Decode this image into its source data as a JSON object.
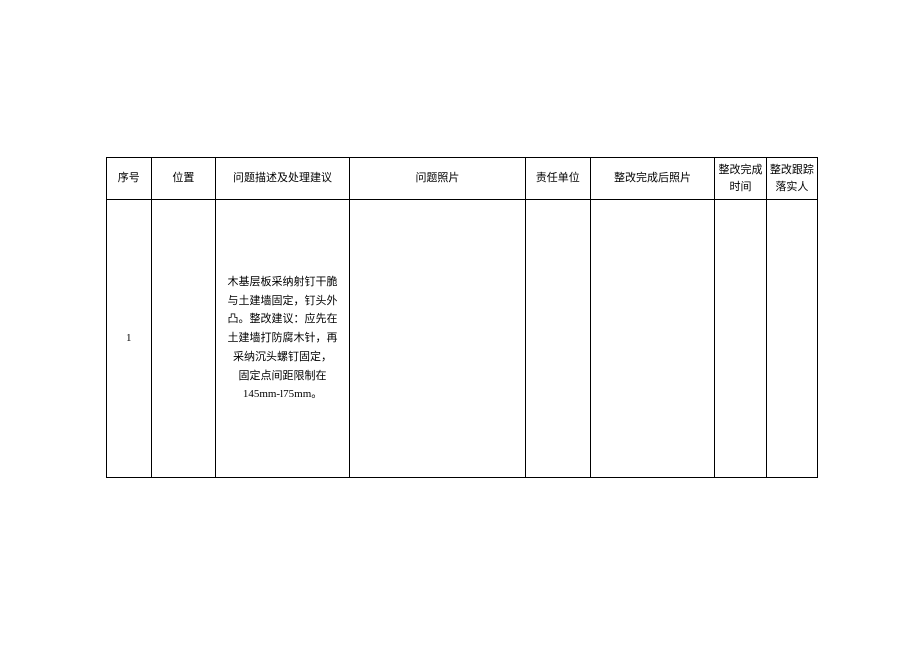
{
  "table": {
    "headers": {
      "seq": "序号",
      "position": "位置",
      "description": "问题描述及处理建议",
      "photo1": "问题照片",
      "responsible": "责任单位",
      "photo2": "整改完成后照片",
      "time": "整改完成时间",
      "person": "整改跟踪落实人"
    },
    "rows": [
      {
        "seq": "1",
        "position": "",
        "description": "木基层板采纳射钉干脆与土建墙固定，钉头外凸。整改建议：应先在土建墙打防腐木针，再采纳沉头螺钉固定，\n固定点间距限制在145mm-l75mm。",
        "photo1": "",
        "responsible": "",
        "photo2": "",
        "time": "",
        "person": ""
      }
    ]
  }
}
